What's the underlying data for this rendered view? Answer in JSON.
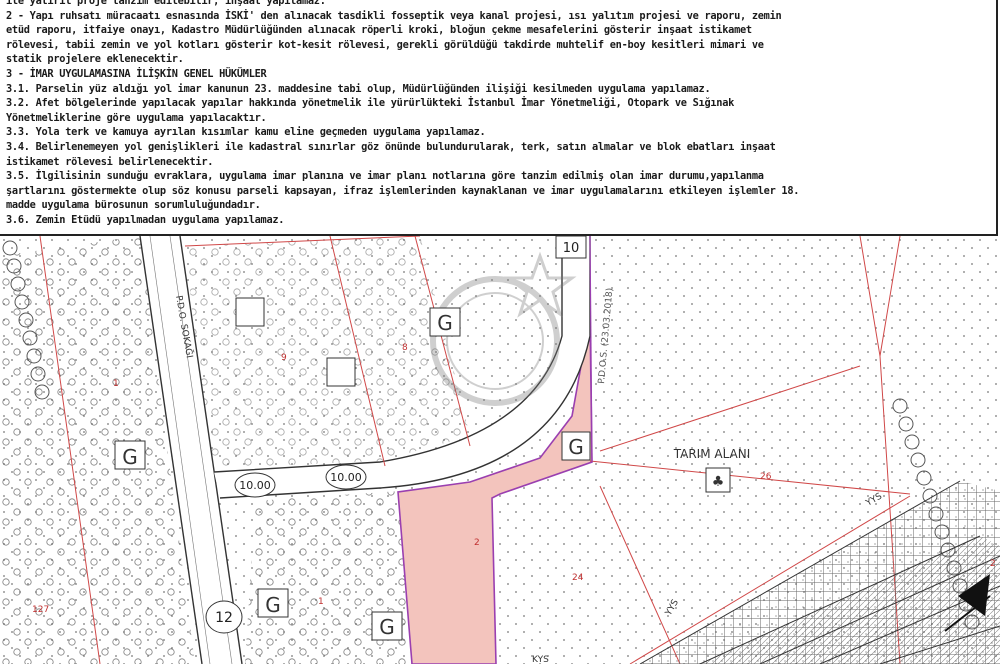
{
  "notes": {
    "lines": [
      "ile yatırıl proje tanzim edilebilir, inşaat yapılamaz.",
      "2 - Yapı ruhsatı müracaatı esnasında İSKİ' den alınacak tasdikli fosseptik veya kanal projesi, ısı yalıtım projesi ve raporu, zemin",
      "etüd raporu, itfaiye onayı, Kadastro Müdürlüğünden alınacak röperli kroki, bloğun çekme mesafelerini gösterir inşaat istikamet",
      "rölevesi, tabii zemin ve yol kotları gösterir kot-kesit rölevesi, gerekli görüldüğü takdirde muhtelif en-boy kesitleri mimari ve",
      "statik projelere eklenecektir.",
      "3 - İMAR UYGULAMASINA İLİŞKİN GENEL HÜKÜMLER",
      " 3.1. Parselin yüz aldığı yol imar kanunun 23. maddesine tabi olup, Müdürlüğünden ilişiği kesilmeden uygulama yapılamaz.",
      " 3.2. Afet bölgelerinde yapılacak yapılar hakkında yönetmelik ile yürürlükteki İstanbul İmar Yönetmeliği, Otopark ve Sığınak",
      "Yönetmeliklerine göre uygulama yapılacaktır.",
      " 3.3. Yola terk ve kamuya ayrılan kısımlar kamu eline geçmeden uygulama yapılamaz.",
      " 3.4. Belirlenemeyen yol genişlikleri ile kadastral sınırlar göz önünde bulundurularak, terk, satın almalar ve blok ebatları inşaat",
      "istikamet rölevesi belirlenecektir.",
      " 3.5. İlgilisinin sunduğu evraklara, uygulama imar planına ve imar planı notlarına göre tanzim edilmiş olan imar durumu,yapılanma",
      "şartlarını göstermekte olup söz konusu parseli kapsayan, ifraz işlemlerinden kaynaklanan ve imar uygulamalarını etkileyen işlemler 18.",
      "madde uygulama bürosunun sorumluluğundadır.",
      " 3.6. Zemin Etüdü yapılmadan uygulama yapılamaz."
    ]
  },
  "map": {
    "zone_labels": [
      "G",
      "G",
      "G",
      "G",
      "G"
    ],
    "road_widths": [
      "10.00",
      "10.00",
      "12",
      "10"
    ],
    "road_name": "P.D.O. SOKAĞI",
    "pdos_label": "P.D.O.S. (23.03.2018)",
    "area_label": "TARIM ALANI",
    "parcel_numbers": [
      "1",
      "9",
      "8",
      "26",
      "2",
      "24",
      "127",
      "1",
      "2"
    ],
    "yys_labels": [
      "YYS",
      "YYS",
      "KYS"
    ],
    "colors": {
      "highlight_fill": "#f3c4bd",
      "highlight_stroke": "#9a3fb0",
      "parcel_line": "#d04848",
      "road_line": "#333333",
      "tree_line": "#555555"
    }
  }
}
